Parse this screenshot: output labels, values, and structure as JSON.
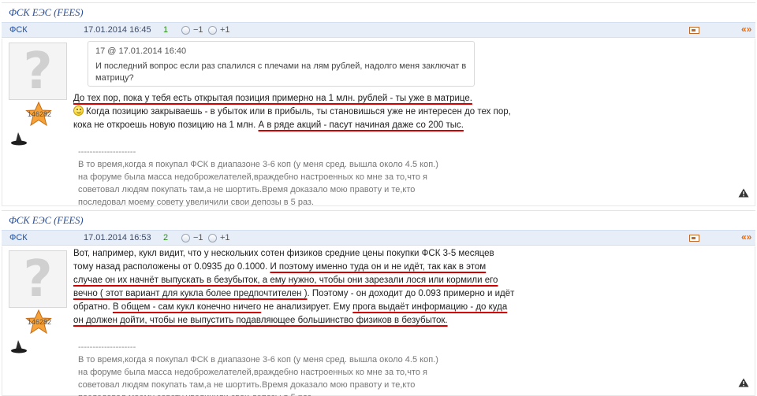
{
  "posts": [
    {
      "topic_title": "ФСК ЕЭС (FEES)",
      "author": "ФСК",
      "date": "17.01.2014 16:45",
      "rating": "1",
      "vote_minus": "−1",
      "vote_plus": "+1",
      "quote_link": "«»",
      "avatar_badge": "146282",
      "quote": {
        "header": "17 @ 17.01.2014 16:40",
        "text": "И последний вопрос если раз спалился с плечами на лям рублей, надолго меня заключат в матрицу?"
      },
      "message": {
        "line1": "До тех пор, пока у тебя есть открытая позиция примерно на 1 млн. рублей - ты уже в матрице.",
        "line2": "Когда позицию закрываешь - в убыток или в прибыль, ты становишься уже не интересен до тех пор, кока не откроешь новую позицию на 1 млн.",
        "line3": "А в ряде акций - пасут начиная даже со 200 тыс."
      },
      "signature": {
        "separator": "--------------------",
        "text": "В то время,когда я покупал ФСК в диапазоне 3-6 коп (у меня сред. вышла около 4.5 коп.) на форуме была масса недоброжелателей,враждебно настроенных ко мне за то,что я советовал людям покупать там,а не шортить.Время доказало мою правоту и те,кто последовал моему совету увеличили свои депозы в 5 раз."
      }
    },
    {
      "topic_title": "ФСК ЕЭС (FEES)",
      "author": "ФСК",
      "date": "17.01.2014 16:53",
      "rating": "2",
      "vote_minus": "−1",
      "vote_plus": "+1",
      "quote_link": "«»",
      "avatar_badge": "146282",
      "message": {
        "part1": "Вот, например, кукл видит, что у нескольких сотен физиков средние цены покупки ФСК 3-5 месяцев тому назад расположены от 0.0935 до 0.1000. ",
        "part2": "И поэтому именно туда он и не идёт, так как в этом случае он их начнёт выпускать в безубыток, а ему нужно, чтобы они зарезали лося или кормили его вечно ( этот вариант для кукла более предпочтителен )",
        "part3": ". Поэтому - он доходит до 0.093 примерно и идёт обратно. ",
        "part4": "В общем - сам кукл конечно ничего",
        "part5": " не анализирует. Ему ",
        "part6": "прога выдаёт информацию - до куда он должен дойти, чтобы не выпустить подавляющее большинство физиков в безубыток."
      },
      "signature": {
        "separator": "--------------------",
        "text": "В то время,когда я покупал ФСК в диапазоне 3-6 коп (у меня сред. вышла около 4.5 коп.) на форуме была масса недоброжелателей,враждебно настроенных ко мне за то,что я советовал людям покупать там,а не шортить.Время доказало мою правоту и те,кто последовал моему совету увеличили свои депозы в 5 раз."
      }
    }
  ]
}
